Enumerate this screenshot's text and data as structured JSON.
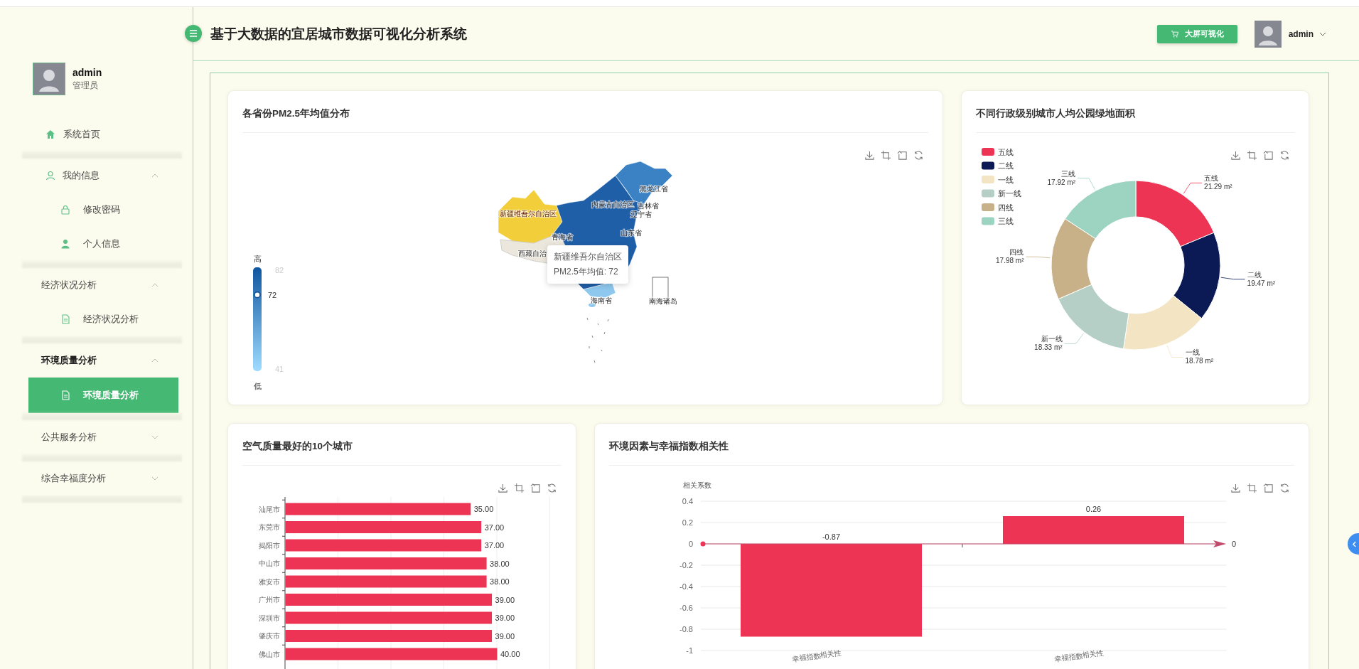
{
  "header": {
    "title": "基于大数据的宜居城市数据可视化分析系统",
    "screen_button": "大屏可视化",
    "user": "admin"
  },
  "sidebar": {
    "user": {
      "name": "admin",
      "role": "管理员"
    },
    "menu": [
      {
        "kind": "link",
        "label": "系统首页",
        "selected": false
      },
      {
        "kind": "group",
        "label": "我的信息",
        "expanded": true,
        "children": [
          {
            "label": "修改密码",
            "selected": false
          },
          {
            "label": "个人信息",
            "selected": false
          }
        ]
      },
      {
        "kind": "group",
        "label": "经济状况分析",
        "expanded": true,
        "children": [
          {
            "label": "经济状况分析",
            "selected": false
          }
        ]
      },
      {
        "kind": "group",
        "label": "环境质量分析",
        "expanded": true,
        "children": [
          {
            "label": "环境质量分析",
            "selected": true
          }
        ]
      },
      {
        "kind": "group",
        "label": "公共服务分析",
        "expanded": false
      },
      {
        "kind": "group",
        "label": "综合幸福度分析",
        "expanded": false
      }
    ]
  },
  "pm25_map": {
    "title": "各省份PM2.5年均值分布",
    "scale": {
      "high": "高",
      "low": "低",
      "max": "82",
      "min": "41",
      "value": "72",
      "level": 0.756
    },
    "region_labels": [
      "新疆维吾尔自治区",
      "西藏自治",
      "青海省",
      "内蒙古自治区",
      "黑龙江省",
      "吉林省",
      "辽宁省",
      "山东省",
      "海南省",
      "南海诸岛"
    ],
    "tooltip": {
      "region": "新疆维吾尔自治区",
      "reading": "PM2.5年均值: 72"
    }
  },
  "green_area": {
    "title": "不同行政级别城市人均公园绿地面积",
    "legend": [
      {
        "label": "五线",
        "color": "#ee3454"
      },
      {
        "label": "二线",
        "color": "#0b1a55"
      },
      {
        "label": "一线",
        "color": "#f3e5c3"
      },
      {
        "label": "新一线",
        "color": "#b6cfc6"
      },
      {
        "label": "四线",
        "color": "#c8b089"
      },
      {
        "label": "三线",
        "color": "#9dd3c1"
      }
    ],
    "chart_data": {
      "type": "donut",
      "categories": [
        "五线",
        "二线",
        "一线",
        "新一线",
        "四线",
        "三线"
      ],
      "values": [
        21.29,
        19.47,
        18.78,
        18.33,
        17.98,
        17.92
      ],
      "value_labels": [
        "21.29 m²",
        "19.47 m²",
        "18.78 m²",
        "18.33 m²",
        "17.98 m²",
        "17.92 m²"
      ]
    }
  },
  "air_quality": {
    "title": "空气质量最好的10个城市",
    "chart_data": {
      "type": "bar",
      "orientation": "horizontal",
      "categories": [
        "汕尾市",
        "东莞市",
        "揭阳市",
        "中山市",
        "雅安市",
        "广州市",
        "深圳市",
        "肇庆市",
        "佛山市"
      ],
      "values": [
        35,
        37,
        37,
        38,
        38,
        39,
        39,
        39,
        40
      ],
      "value_labels": [
        "35.00",
        "37.00",
        "37.00",
        "38.00",
        "38.00",
        "39.00",
        "39.00",
        "39.00",
        "40.00"
      ]
    }
  },
  "correlation": {
    "title": "环境因素与幸福指数相关性",
    "chart_data": {
      "type": "bar",
      "ylabel": "相关系数",
      "categories": [
        "幸福指数相关性",
        "幸福指数相关性"
      ],
      "values": [
        -0.87,
        0.26
      ],
      "ylim": [
        -1,
        0.4
      ],
      "yticks": [
        0.4,
        0.2,
        0,
        -0.2,
        -0.4,
        -0.6,
        -0.8,
        -1
      ],
      "data_labels": true,
      "grid": true,
      "ref_lines": [
        {
          "axis": "y",
          "value": 0,
          "label": "0"
        }
      ]
    }
  }
}
